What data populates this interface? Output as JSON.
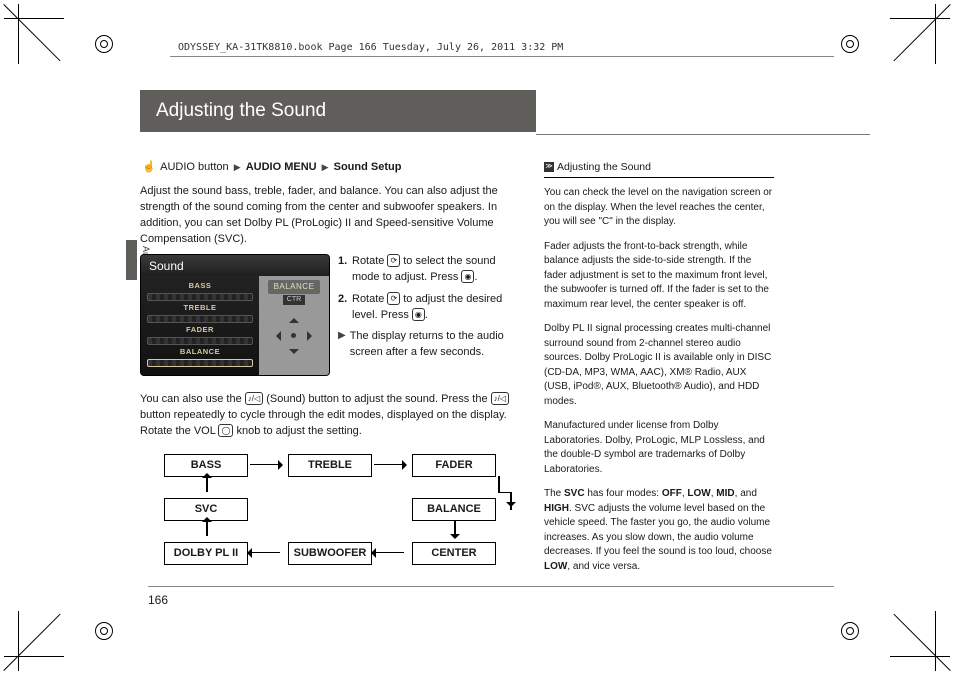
{
  "header": {
    "stamp": "ODYSSEY_KA-31TK8810.book  Page 166  Tuesday, July 26, 2011  3:32 PM"
  },
  "title": "Adjusting the Sound",
  "side_tab_label": "Audio",
  "breadcrumb": {
    "b1": "AUDIO button",
    "b2": "AUDIO MENU",
    "b3": "Sound Setup"
  },
  "intro": "Adjust the sound bass, treble, fader, and balance. You can also adjust the strength of the sound coming from the center and subwoofer speakers. In addition, you can set Dolby PL (ProLogic) II and Speed-sensitive Volume Compensation (SVC).",
  "screenshot": {
    "title": "Sound",
    "rows": [
      "BASS",
      "TREBLE",
      "FADER",
      "BALANCE"
    ],
    "right_label": "BALANCE",
    "right_sub": "CTR"
  },
  "steps": {
    "s1_a": "Rotate ",
    "s1_b": " to select the sound mode to adjust. Press ",
    "s1_c": ".",
    "s2_a": "Rotate ",
    "s2_b": " to adjust the desired level. Press ",
    "s2_c": ".",
    "note": "The display returns to the audio screen after a few seconds."
  },
  "below": {
    "p1_a": "You can also use the ",
    "p1_b": " (Sound) button to adjust the sound. Press the ",
    "p1_c": " button repeatedly to cycle through the edit modes, displayed on the display. Rotate the VOL ",
    "p1_d": " knob to adjust the setting."
  },
  "flow": {
    "bass": "BASS",
    "treble": "TREBLE",
    "fader": "FADER",
    "svc": "SVC",
    "balance": "BALANCE",
    "dolby": "DOLBY PL II",
    "sub": "SUBWOOFER",
    "center": "CENTER"
  },
  "sidebar": {
    "title": "Adjusting the Sound",
    "p1": "You can check the level on the navigation screen or on the display. When the level reaches the center, you will see \"C\" in the display.",
    "p2": "Fader adjusts the front-to-back strength, while balance adjusts the side-to-side strength. If the fader adjustment is set to the maximum front level, the subwoofer is turned off. If the fader is set to the maximum rear level, the center speaker is off.",
    "p3": "Dolby PL II signal processing creates multi-channel surround sound from 2-channel stereo audio sources. Dolby ProLogic II is available only in DISC (CD-DA, MP3, WMA, AAC), XM® Radio, AUX (USB, iPod®, AUX, Bluetooth® Audio), and HDD modes.",
    "p4": "Manufactured under license from Dolby Laboratories. Dolby, ProLogic, MLP Lossless, and the double-D symbol are trademarks of Dolby Laboratories.",
    "p5_a": "The ",
    "p5_svc": "SVC",
    "p5_b": " has four modes: ",
    "p5_off": "OFF",
    "p5_low": "LOW",
    "p5_mid": "MID",
    "p5_c": ", and ",
    "p5_high": "HIGH",
    "p5_d": ". SVC adjusts the volume level based on the vehicle speed. The faster you go, the audio volume increases. As you slow down, the audio volume decreases. If you feel the sound is too loud, choose ",
    "p5_low2": "LOW",
    "p5_e": ", and vice versa."
  },
  "page_number": "166"
}
